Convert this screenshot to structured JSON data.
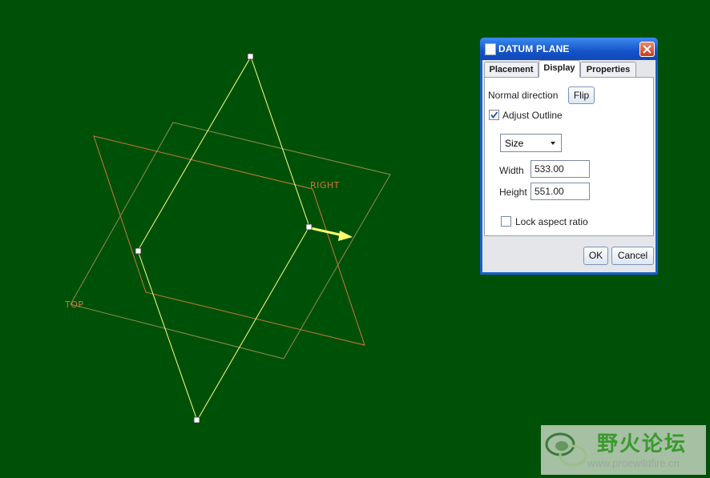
{
  "viewport": {
    "datum_labels": {
      "right": "RIGHT",
      "top": "TOP"
    }
  },
  "dialog": {
    "title": "DATUM PLANE",
    "tabs": [
      {
        "label": "Placement",
        "active": false
      },
      {
        "label": "Display",
        "active": true
      },
      {
        "label": "Properties",
        "active": false
      }
    ],
    "display": {
      "normal_direction_label": "Normal direction",
      "flip_label": "Flip",
      "adjust_outline_label": "Adjust Outline",
      "adjust_outline_checked": true,
      "size_mode": "Size",
      "width_label": "Width",
      "width_value": "533.00",
      "height_label": "Height",
      "height_value": "551.00",
      "lock_aspect_label": "Lock aspect ratio",
      "lock_aspect_checked": false
    },
    "ok_label": "OK",
    "cancel_label": "Cancel"
  },
  "watermark": {
    "title": "野火论坛",
    "url": "www.proewildfire.cn"
  },
  "colors": {
    "background": "#005108",
    "selected_plane": "#ffff80",
    "datum_orange": "#c8783a",
    "datum_olive": "#8a8a4a"
  }
}
